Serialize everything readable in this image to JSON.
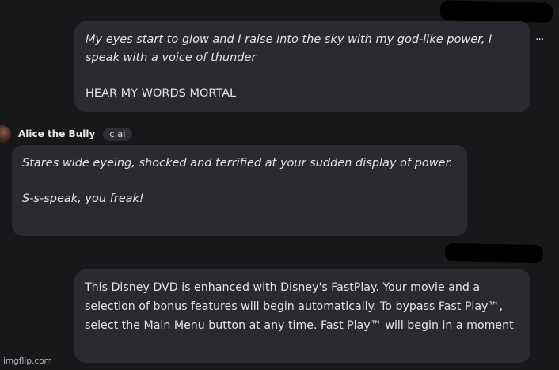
{
  "messages": [
    {
      "author": "",
      "paragraphs": [
        "My eyes start to glow and I raise into the sky with my god-like power, I speak with a voice of thunder",
        "HEAR MY WORDS MORTAL"
      ]
    },
    {
      "author": "Alice the Bully",
      "badge": "c.ai",
      "paragraphs": [
        "Stares wide eyeing, shocked and terrified at your sudden display of power.",
        "S-s-speak, you freak!"
      ]
    },
    {
      "author": "",
      "paragraphs": [
        "This Disney DVD is enhanced with Disney's FastPlay. Your movie and a selection of bonus features will begin automatically. To bypass Fast Play™, select the Main Menu button at any time. Fast Play™ will begin in a moment"
      ]
    }
  ],
  "more_button": "···",
  "watermark": "imgflip.com",
  "colors": {
    "background": "#18181b",
    "bubble": "#2a2a30",
    "text": "#e4e4e8",
    "redaction": "#000000"
  }
}
